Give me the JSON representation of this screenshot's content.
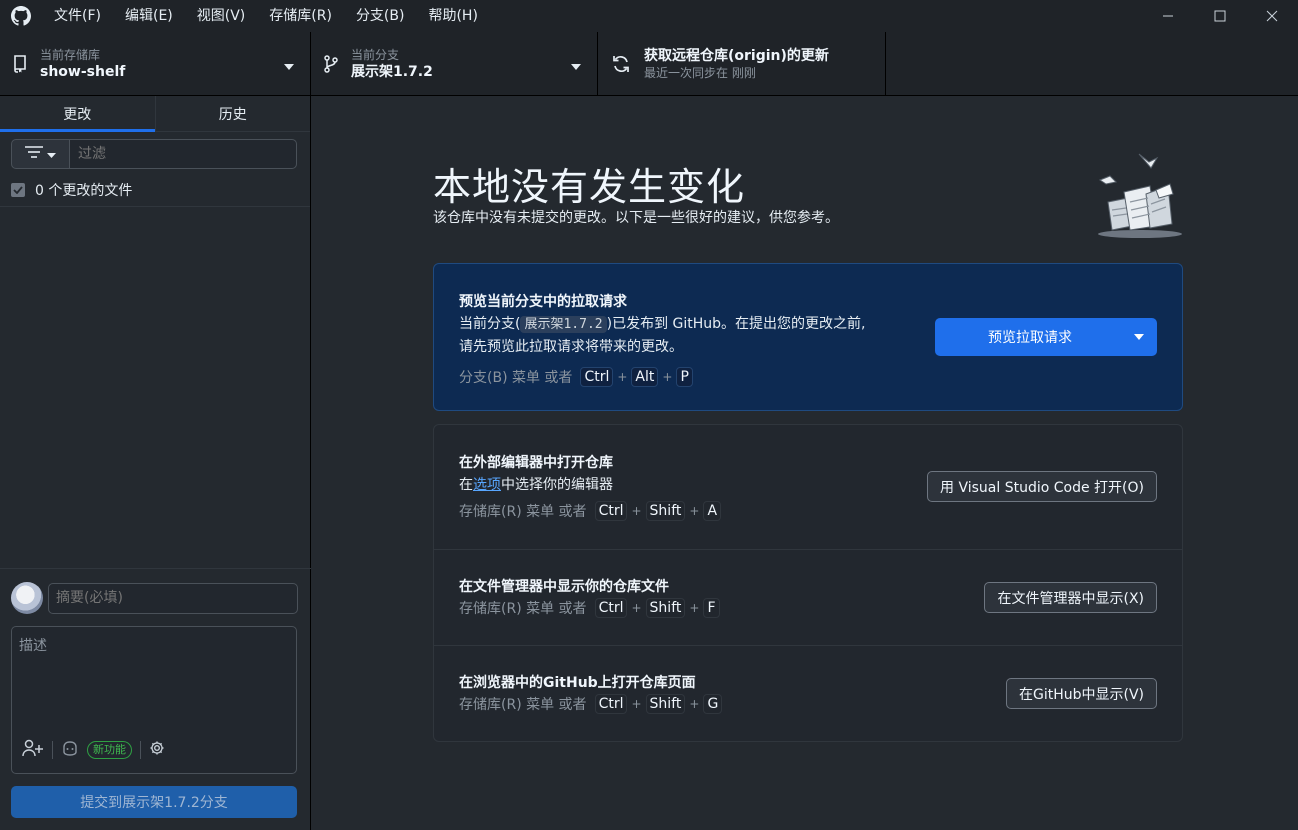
{
  "menu": [
    "文件(F)",
    "编辑(E)",
    "视图(V)",
    "存储库(R)",
    "分支(B)",
    "帮助(H)"
  ],
  "toolbar": {
    "repo_small": "当前存储库",
    "repo_name": "show-shelf",
    "branch_small": "当前分支",
    "branch_name": "展示架1.7.2",
    "fetch_title": "获取远程仓库(origin)的更新",
    "fetch_sub": "最近一次同步在 刚刚"
  },
  "sidebar": {
    "tab_changes": "更改",
    "tab_history": "历史",
    "filter_placeholder": "过滤",
    "changed_files": "0 个更改的文件",
    "summary_placeholder": "摘要(必填)",
    "description_placeholder": "描述",
    "new_feature_badge": "新功能",
    "commit_button": "提交到展示架1.7.2分支"
  },
  "main": {
    "heading": "本地没有发生变化",
    "subheading": "该仓库中没有未提交的更改。以下是一些很好的建议，供您参考。",
    "pr_card": {
      "title": "预览当前分支中的拉取请求",
      "text_before": "当前分支(",
      "branch_code": "展示架1.7.2",
      "text_after": ")已发布到 GitHub。在提出您的更改之前,",
      "text_line2": "请先预览此拉取请求将带来的更改。",
      "hint_menu": "分支(B) 菜单 或者",
      "keys": [
        "Ctrl",
        "Alt",
        "P"
      ],
      "button": "预览拉取请求"
    },
    "editor_card": {
      "title": "在外部编辑器中打开仓库",
      "text_before": "在",
      "link": "选项",
      "text_after": "中选择你的编辑器",
      "hint_menu": "存储库(R) 菜单 或者",
      "keys": [
        "Ctrl",
        "Shift",
        "A"
      ],
      "button": "用 Visual Studio Code 打开(O)"
    },
    "explorer_card": {
      "title": "在文件管理器中显示你的仓库文件",
      "hint_menu": "存储库(R) 菜单 或者",
      "keys": [
        "Ctrl",
        "Shift",
        "F"
      ],
      "button": "在文件管理器中显示(X)"
    },
    "github_card": {
      "title": "在浏览器中的GitHub上打开仓库页面",
      "hint_menu": "存储库(R) 菜单 或者",
      "keys": [
        "Ctrl",
        "Shift",
        "G"
      ],
      "button": "在GitHub中显示(V)"
    }
  },
  "colors": {
    "accent": "#1f6feb",
    "background": "#24292f",
    "toolbar": "#1f2328",
    "pr_card_bg": "#0d2a52"
  }
}
